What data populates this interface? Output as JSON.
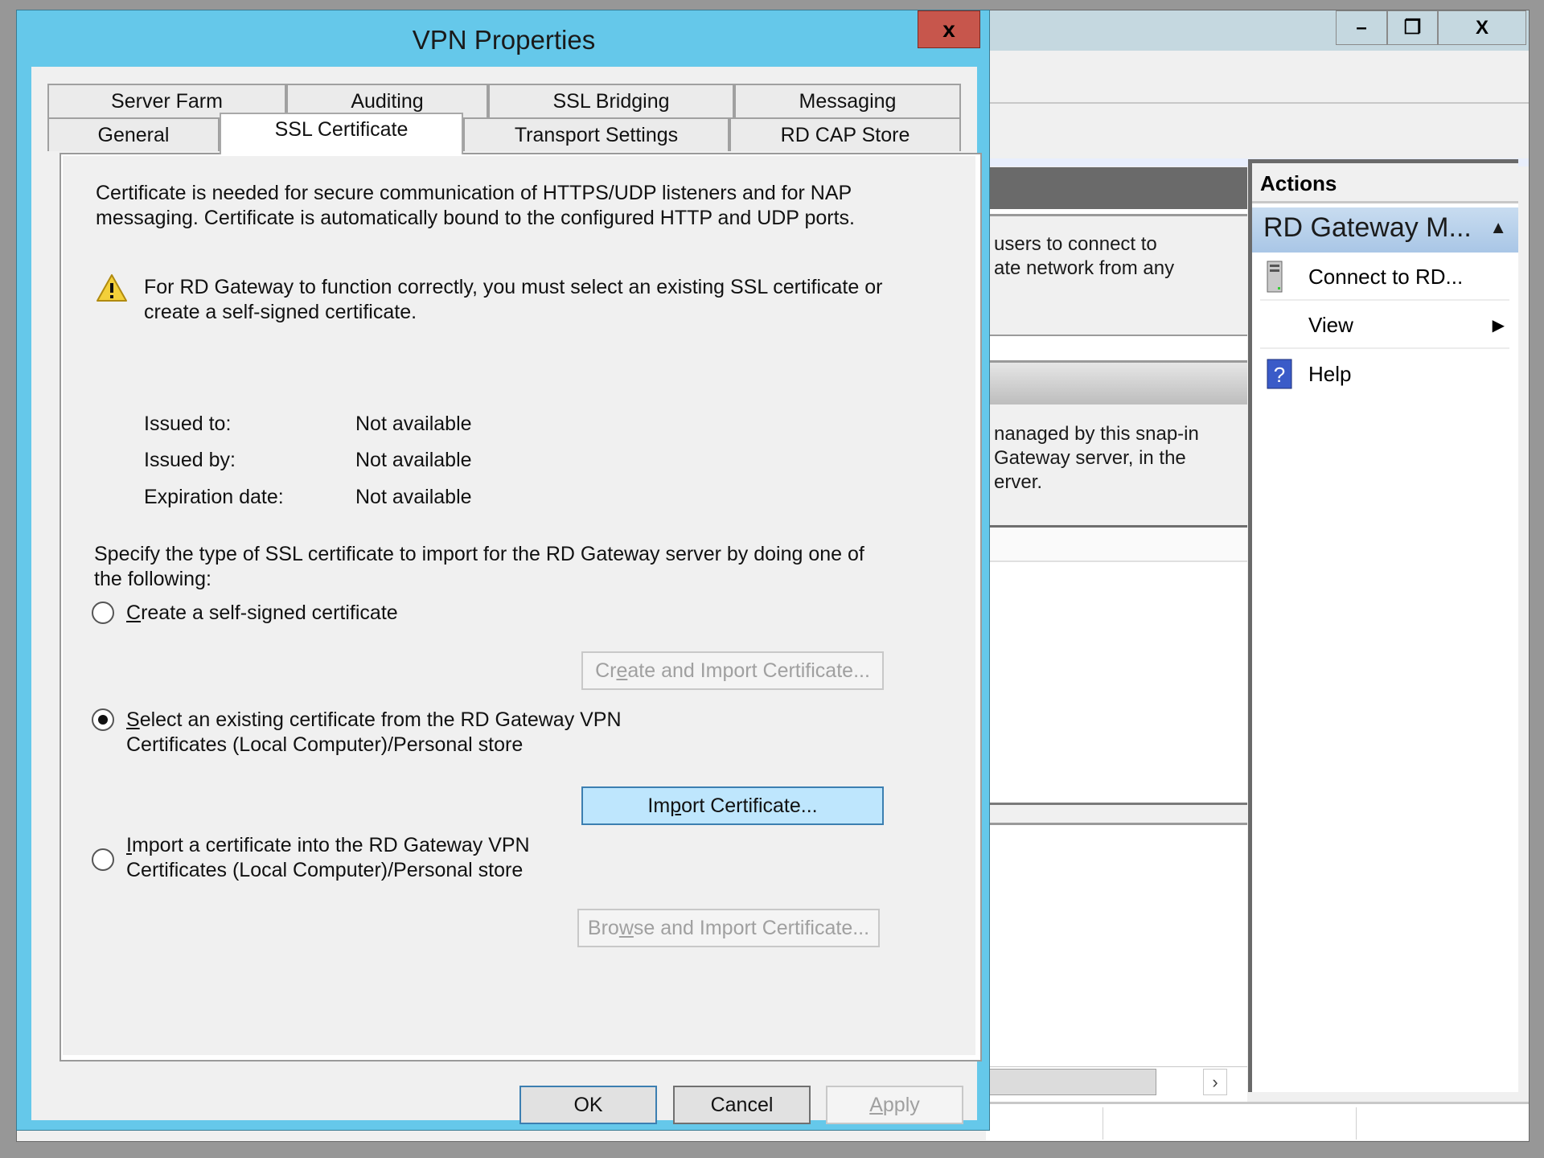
{
  "background_window": {
    "window_controls": {
      "minimize": "–",
      "restore": "❐",
      "close": "X"
    },
    "center_pane": {
      "description_1": [
        "users to connect to",
        "ate network from any"
      ],
      "description_2": [
        "nanaged by this snap-in",
        " Gateway server, in the",
        "erver."
      ]
    },
    "actions": {
      "title": "Actions",
      "group_label": "RD Gateway M...",
      "items": [
        {
          "label": "Connect to RD...",
          "icon": "server-icon",
          "has_submenu": false
        },
        {
          "label": "View",
          "icon": "none",
          "has_submenu": true
        },
        {
          "label": "Help",
          "icon": "help-icon",
          "has_submenu": false
        }
      ]
    },
    "scroll_right": "›"
  },
  "dialog": {
    "title": "VPN Properties",
    "close_label": "x",
    "tabs_row1": [
      "Server Farm",
      "Auditing",
      "SSL Bridging",
      "Messaging"
    ],
    "tabs_row2": [
      "General",
      "SSL Certificate",
      "Transport Settings",
      "RD CAP Store"
    ],
    "selected_tab": "SSL Certificate",
    "intro": [
      "Certificate is needed for secure communication of HTTPS/UDP listeners and for NAP",
      "messaging. Certificate is automatically bound to the configured HTTP and UDP ports."
    ],
    "warning": [
      "For RD Gateway to function correctly, you must select an existing SSL certificate or",
      "create a self-signed certificate."
    ],
    "cert_info": [
      {
        "label": "Issued to:",
        "value": "Not available"
      },
      {
        "label": "Issued by:",
        "value": "Not available"
      },
      {
        "label": "Expiration date:",
        "value": "Not available"
      }
    ],
    "specify": [
      "Specify the type of SSL certificate to import for the RD Gateway server by doing one of",
      "the following:"
    ],
    "options": [
      {
        "line1_key": "C",
        "line1_rest": "reate a self-signed certificate",
        "line2": "",
        "selected": false,
        "button": {
          "pre": "Cr",
          "key": "e",
          "post": "ate and Import Certificate...",
          "enabled": false
        }
      },
      {
        "line1_key": "S",
        "line1_rest": "elect an existing certificate from the RD Gateway VPN",
        "line2": "Certificates (Local Computer)/Personal store",
        "selected": true,
        "button": {
          "pre": "Im",
          "key": "p",
          "post": "ort Certificate...",
          "enabled": true
        }
      },
      {
        "line1_key": "I",
        "line1_rest": "mport a certificate into the RD Gateway VPN",
        "line2": "Certificates (Local Computer)/Personal store",
        "selected": false,
        "button": {
          "pre": "Bro",
          "key": "w",
          "post": "se and Import Certificate...",
          "enabled": false
        }
      }
    ],
    "footer": {
      "ok": "OK",
      "cancel": "Cancel",
      "apply_key": "A",
      "apply_rest": "pply"
    }
  }
}
